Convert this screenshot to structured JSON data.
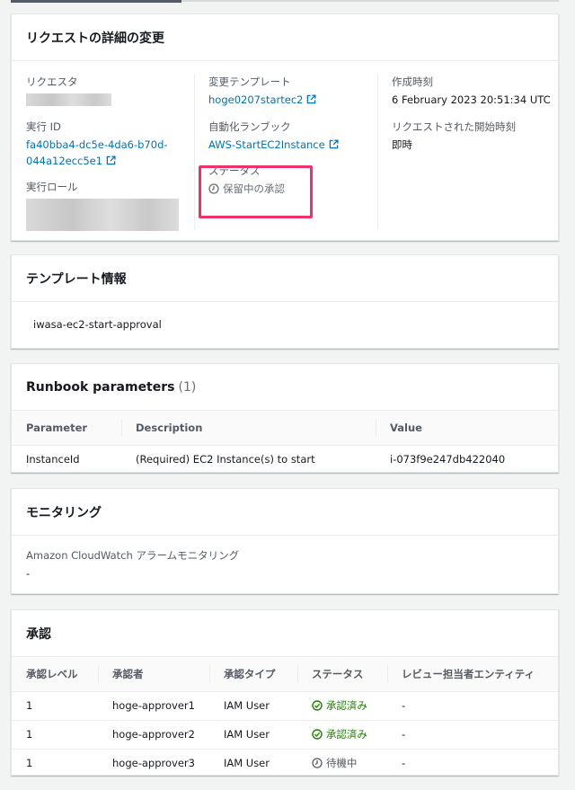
{
  "details": {
    "title": "リクエストの詳細の変更",
    "requester_label": "リクエスタ",
    "execution_id_label": "実行 ID",
    "execution_id_line1": "fa40bba4-dc5e-4da6-b70d-",
    "execution_id_line2": "044a12ecc5e1",
    "execution_role_label": "実行ロール",
    "template_label": "変更テンプレート",
    "template_value": "hoge0207startec2",
    "runbook_label": "自動化ランブック",
    "runbook_value": "AWS-StartEC2Instance",
    "status_label": "ステータス",
    "status_value": "保留中の承認",
    "created_label": "作成時刻",
    "created_value": "6 February 2023 20:51:34 UTC",
    "requested_start_label": "リクエストされた開始時刻",
    "requested_start_value": "即時"
  },
  "template_info": {
    "title": "テンプレート情報",
    "name": "iwasa-ec2-start-approval"
  },
  "params": {
    "title": "Runbook parameters",
    "count": "(1)",
    "headers": [
      "Parameter",
      "Description",
      "Value"
    ],
    "rows": [
      [
        "InstanceId",
        "(Required) EC2 Instance(s) to start",
        "i-073f9e247db422040"
      ]
    ]
  },
  "monitoring": {
    "title": "モニタリング",
    "label": "Amazon CloudWatch アラームモニタリング",
    "value": "-"
  },
  "approval": {
    "title": "承認",
    "headers": [
      "承認レベル",
      "承認者",
      "承認タイプ",
      "ステータス",
      "レビュー担当者エンティティ"
    ],
    "rows": [
      {
        "level": "1",
        "approver": "hoge-approver1",
        "type": "IAM User",
        "status": "承認済み",
        "status_kind": "approved",
        "entity": "-"
      },
      {
        "level": "1",
        "approver": "hoge-approver2",
        "type": "IAM User",
        "status": "承認済み",
        "status_kind": "approved",
        "entity": "-"
      },
      {
        "level": "1",
        "approver": "hoge-approver3",
        "type": "IAM User",
        "status": "待機中",
        "status_kind": "waiting",
        "entity": "-"
      }
    ]
  },
  "colors": {
    "link": "#0073bb",
    "success": "#1d8102",
    "highlight": "#f0306a"
  }
}
